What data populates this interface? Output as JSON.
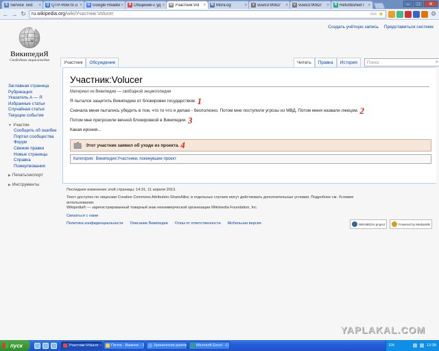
{
  "browser": {
    "tabs": [
      {
        "title": "Service Test",
        "color": "#4a86c8",
        "glyph": "S"
      },
      {
        "title": "QTP-How to u",
        "color": "#3b7bd8",
        "glyph": "Q"
      },
      {
        "title": "Google Reader",
        "color": "#4285f4",
        "glyph": "G"
      },
      {
        "title": "Общение-с уд",
        "color": "#d44",
        "glyph": "Я"
      },
      {
        "title": "Участник:Vol",
        "color": "#888",
        "glyph": "W",
        "active": true
      },
      {
        "title": "MonLog",
        "color": "#5577aa",
        "glyph": "M"
      },
      {
        "title": "vuws3:9082/",
        "color": "#777",
        "glyph": "v"
      },
      {
        "title": "vuws3:9082/",
        "color": "#777",
        "glyph": "v"
      },
      {
        "title": "Refurbished I",
        "color": "#2a7",
        "glyph": "R"
      }
    ],
    "address": {
      "host": "ru.wikipedia.org",
      "path": "/wiki/Участник:Volucer",
      "css": "css"
    },
    "extensions": [
      "#e8a020",
      "#4b8",
      "#c33",
      "#36c",
      "#d70"
    ]
  },
  "wiki": {
    "logo": {
      "wordmark": "ВикипедиЯ",
      "tagline": "Свободная энциклопедия"
    },
    "personal": {
      "create_account": "Создать учётную запись",
      "login": "Представиться системе"
    },
    "tabs_left": [
      {
        "label": "Участник",
        "selected": true
      },
      {
        "label": "Обсуждение",
        "selected": false
      }
    ],
    "tabs_right": [
      {
        "label": "Читать",
        "selected": true
      },
      {
        "label": "Правка",
        "selected": false
      },
      {
        "label": "История",
        "selected": false
      }
    ],
    "search_placeholder": "Поиск",
    "sidebar": {
      "main": [
        "Заглавная страница",
        "Рубрикация",
        "Указатель А — Я",
        "Избранные статьи",
        "Случайная статья",
        "Текущие события"
      ],
      "participation_header": "Участие",
      "participation": [
        "Сообщить об ошибке",
        "Портал сообщества",
        "Форум",
        "Свежие правки",
        "Новые страницы",
        "Справка",
        "Пожертвования"
      ],
      "print_header": "Печать/экспорт",
      "tools_header": "Инструменты"
    },
    "title": "Участник:Volucer",
    "site_sub": "Материал из Википедии — свободной энциклопедии",
    "paragraphs": [
      {
        "text": "Я пытался защитить Википедию от блокировки государством.",
        "mark": "1"
      },
      {
        "text": "Сначала меня пытались убедить в том, что то что я делаю - бесполезно. Потом мне поступили угрозы из МВД. Потом меня назвали лжецом.",
        "mark": "2"
      },
      {
        "text": "Потом мне пригрозили вечной блокировкой в Википедии.",
        "mark": "3"
      },
      {
        "text": "Какая ирония...",
        "mark": ""
      }
    ],
    "retired_notice": {
      "text": "Этот участник заявил об уходе из проекта.",
      "mark": "4"
    },
    "categories": {
      "label": "Категория:",
      "value": "Википедия:Участники, покинувшие проект"
    },
    "footer": {
      "last_modified": "Последнее изменение этой страницы: 14:31, 11 апреля 2013.",
      "license_text": "Текст доступен по лицензии Creative Commons Attribution-ShareAlike; в отдельных случаях могут действовать дополнительные условия. Подробнее см. Условия использования.",
      "trademark": "Wikipedia® — зарегистрированный товарный знак некоммерческой организации Wikimedia Foundation, Inc.",
      "contact": "Связаться с нами",
      "links": [
        "Политика конфиденциальности",
        "Описание Википедии",
        "Отказ от ответственности",
        "Мобильная версия"
      ],
      "badges": [
        "WIKIMEDIA project",
        "Powered by MediaWiki"
      ]
    }
  },
  "watermark": "YAPLAKAL.COM",
  "taskbar": {
    "start": "пуск",
    "items": [
      {
        "label": "Участник:Volucer — ...",
        "active": true,
        "color": "#e44"
      },
      {
        "label": "Почта - Важное - Зб...",
        "active": false,
        "color": "#fc3"
      },
      {
        "label": "Хронология разгово...",
        "active": false,
        "color": "#6ad"
      },
      {
        "label": "Microsoft Excel - CS...",
        "active": false,
        "color": "#2a6"
      }
    ],
    "lang": "EN",
    "clock": "13:38"
  }
}
